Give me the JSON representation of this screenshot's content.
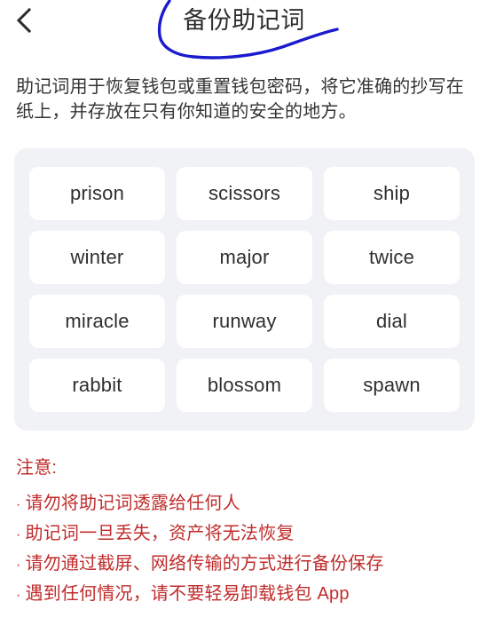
{
  "header": {
    "back_icon": "chevron-left-icon",
    "title": "备份助记词",
    "annotation_color": "#1a1ace"
  },
  "description": "助记词用于恢复钱包或重置钱包密码，将它准确的抄写在纸上，并存放在只有你知道的安全的地方。",
  "mnemonic": {
    "words": [
      "prison",
      "scissors",
      "ship",
      "winter",
      "major",
      "twice",
      "miracle",
      "runway",
      "dial",
      "rabbit",
      "blossom",
      "spawn"
    ]
  },
  "warnings": {
    "title": "注意:",
    "bullet": "·",
    "color": "#c02c2c",
    "items": [
      "请勿将助记词透露给任何人",
      "助记词一旦丢失，资产将无法恢复",
      "请勿通过截屏、网络传输的方式进行备份保存",
      "遇到任何情况，请不要轻易卸载钱包 App"
    ]
  }
}
